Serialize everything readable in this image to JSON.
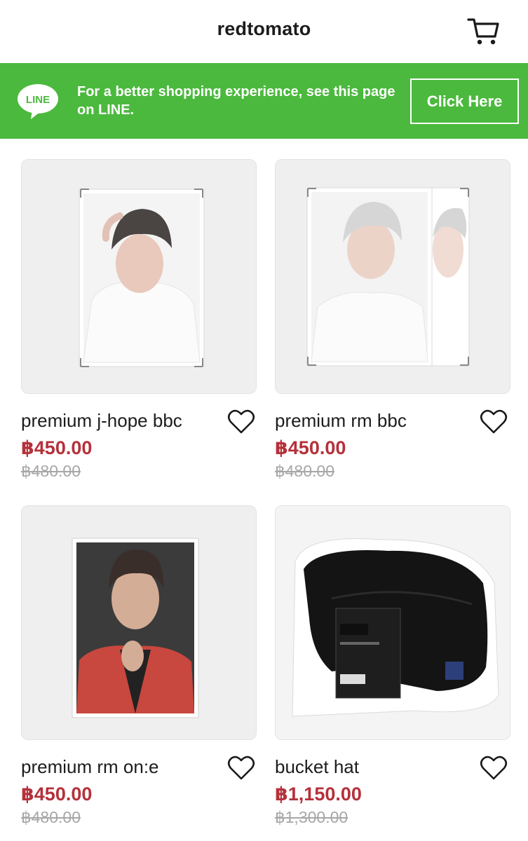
{
  "header": {
    "store_name": "redtomato",
    "cart_icon": "cart-icon"
  },
  "line_banner": {
    "logo_text": "LINE",
    "message": "For a better shopping experience, see this page on LINE.",
    "button_label": "Click Here",
    "color": "#4bb93d"
  },
  "products": [
    {
      "name": "premium j-hope bbc",
      "price": "฿450.00",
      "original_price": "฿480.00",
      "image": "photo of a person in white shirt, framed print",
      "icon": "heart-icon"
    },
    {
      "name": "premium rm bbc",
      "price": "฿450.00",
      "original_price": "฿480.00",
      "image": "photo of a person with silver hair, two framed prints",
      "icon": "heart-icon"
    },
    {
      "name": "premium rm on:e",
      "price": "฿450.00",
      "original_price": "฿480.00",
      "image": "photo of a person in red jacket, framed print",
      "icon": "heart-icon"
    },
    {
      "name": "bucket hat",
      "price": "฿1,150.00",
      "original_price": "฿1,300.00",
      "image": "black bucket hat in plastic packaging",
      "icon": "heart-icon"
    }
  ],
  "colors": {
    "sale_price": "#b5313a",
    "original_price": "#a7a7a7"
  }
}
